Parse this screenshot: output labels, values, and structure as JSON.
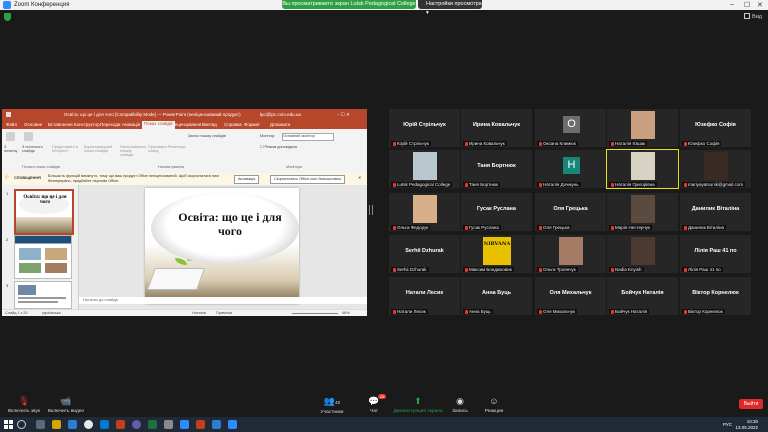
{
  "window": {
    "title": "Zoom Конференция",
    "share_banner": "Вы просматриваете экран Lutsk Pedagogical College",
    "view_options": "Настройки просмотра",
    "view_label": "Вид"
  },
  "ppt": {
    "titlebar": "Освіта: що це і для чого [Compatibility Mode] — PowerPoint (неліцензований продукт)",
    "account": "lpc@lpc.com.edu.ua",
    "tabs": [
      "Файл",
      "Основне",
      "Вставлення",
      "Конструктор",
      "Переходи",
      "Анімація",
      "Показ слайдів",
      "Рецензування",
      "Вигляд",
      "Справка",
      "Формат",
      "Допомога"
    ],
    "active_tab": "Показ слайдів",
    "ribbon": {
      "b1": "З початку",
      "b2": "З поточного слайда",
      "b3": "Представити в Інтернеті",
      "b4": "Користувацький показ слайдів",
      "b5": "Настроювання показу слайдів",
      "b6": "Приховати слайд",
      "b7": "Репетиція",
      "b8": "Запис показу слайдів",
      "group1": "Почати показ слайдів",
      "group2": "Налаштування",
      "group3": "Монітори",
      "monitor_label": "Монітор:",
      "monitor_value": "Основний монітор",
      "presenter": "Режим доповідача"
    },
    "infobar": {
      "title": "СПОВІЩЕННЯ",
      "text": "Більшість функцій вимкнуто, тому що ваш продукт Office неліцензований. Щоб скористатися ним безперервно, придбайте ліцензію Office.",
      "btn1": "Активація",
      "btn2": "Скористатись Office.com безкоштовно"
    },
    "thumbs": [
      {
        "num": "1",
        "title": "Освіта: що це і для чого"
      },
      {
        "num": "2",
        "title": ""
      },
      {
        "num": "3",
        "title": ""
      }
    ],
    "slide_title": "Освіта: що це і для чого",
    "notes": "Нотатки до слайда",
    "status_left": "Слайд 1 з 20",
    "status_lang": "українська",
    "status_notes": "Нотатки",
    "status_comments": "Примітки",
    "zoom": "46%"
  },
  "gallery": [
    {
      "big": "Юрій Стрільчук",
      "label": "Юрій Стрільчук",
      "kind": "name"
    },
    {
      "big": "Ирина Ковальчук",
      "label": "Ирина Ковальчук",
      "kind": "name"
    },
    {
      "big": "",
      "label": "Оксана Климюк",
      "kind": "letter",
      "letter": "O",
      "color": "#6d6d6d"
    },
    {
      "big": "",
      "label": "Наталія Юшак",
      "kind": "photo",
      "color": "#caa080"
    },
    {
      "big": "Юзефко Софія",
      "label": "Юзефко Софія",
      "kind": "name"
    },
    {
      "big": "",
      "label": "Lutsk Pedagogical College",
      "kind": "photo",
      "color": "#b9c7cf"
    },
    {
      "big": "Таня Бортнюк",
      "label": "Таня Бортнюк",
      "kind": "name"
    },
    {
      "big": "",
      "label": "Наталія Дочмунь",
      "kind": "letter",
      "letter": "H",
      "color": "#17867a"
    },
    {
      "big": "",
      "label": "Наталія Григорівна",
      "kind": "photo",
      "color": "#d7d2c2",
      "active": true
    },
    {
      "big": "",
      "label": "mariyayatsunik@gmail.com",
      "kind": "photo",
      "color": "#3a2a24"
    },
    {
      "big": "",
      "label": "Ольга Федорук",
      "kind": "photo",
      "color": "#d7b08a"
    },
    {
      "big": "Гусак Руслана",
      "label": "Гусак Руслана",
      "kind": "name"
    },
    {
      "big": "Оля Грецька",
      "label": "Оля Грецька",
      "kind": "name"
    },
    {
      "big": "",
      "label": "Марія Нестерчук",
      "kind": "photo",
      "color": "#5b4a3e"
    },
    {
      "big": "Данилик Віталіна",
      "label": "Данилик Віталіна",
      "kind": "name"
    },
    {
      "big": "Serhii Dzhurak",
      "label": "Serhii Dzhurak",
      "kind": "name"
    },
    {
      "big": "NIRVANA",
      "label": "Максим Бондюковик",
      "kind": "nirvana"
    },
    {
      "big": "",
      "label": "Ольга Троянчук",
      "kind": "photo",
      "color": "#a57b66"
    },
    {
      "big": "",
      "label": "Nadia Knyish",
      "kind": "photo",
      "color": "#4a3a30"
    },
    {
      "big": "Лілія Раш 41 по",
      "label": "Лілія Раш 41 по",
      "kind": "name"
    },
    {
      "big": "Натали Лесик",
      "label": "Натали Лесик",
      "kind": "name"
    },
    {
      "big": "Анна Буць",
      "label": "Анна Буць",
      "kind": "name"
    },
    {
      "big": "Оля Михальчук",
      "label": "Оля Михальчук",
      "kind": "name"
    },
    {
      "big": "Бойчук Наталія",
      "label": "Бойчук Наталія",
      "kind": "name"
    },
    {
      "big": "Віктор Корнелюк",
      "label": "Віктор Корнелюк",
      "kind": "name"
    }
  ],
  "toolbar": {
    "unmute": "Включить звук",
    "video": "Включить видео",
    "participants": "Участники",
    "participants_count": "40",
    "chat": "Чат",
    "chat_badge": "28",
    "share": "Демонстрация экрана",
    "record": "Запись",
    "reactions": "Реакции",
    "leave": "Выйти"
  },
  "taskbar": {
    "lang": "РУС",
    "time": "10:30",
    "date": "13.05.2022"
  },
  "colors": {
    "ppt_accent": "#b7472a",
    "zoom_green": "#2ea043",
    "leave_red": "#e02828",
    "active_speaker": "#e2e21b"
  }
}
